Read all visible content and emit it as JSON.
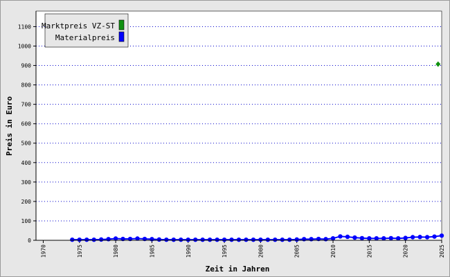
{
  "chart_data": {
    "type": "line",
    "xlabel": "Zeit in Jahren",
    "ylabel": "Preis in Euro",
    "xlim": [
      1969,
      2025
    ],
    "ylim": [
      0,
      1180
    ],
    "x_ticks": [
      1970,
      1975,
      1980,
      1985,
      1990,
      1995,
      2000,
      2005,
      2010,
      2015,
      2020,
      2025
    ],
    "y_ticks": [
      0,
      100,
      200,
      300,
      400,
      500,
      600,
      700,
      800,
      900,
      1000,
      1100
    ],
    "grid": "horizontal-dotted",
    "legend_position": "top-left",
    "series": [
      {
        "name": "Marktpreis VZ-ST",
        "color": "#109010",
        "marker": "diamond",
        "x": [
          2024.5
        ],
        "y": [
          907
        ]
      },
      {
        "name": "Materialpreis",
        "color": "#0000ff",
        "marker": "circle",
        "x": [
          1974,
          1975,
          1976,
          1977,
          1978,
          1979,
          1980,
          1981,
          1982,
          1983,
          1984,
          1985,
          1986,
          1987,
          1988,
          1989,
          1990,
          1991,
          1992,
          1993,
          1994,
          1995,
          1996,
          1997,
          1998,
          1999,
          2000,
          2001,
          2002,
          2003,
          2004,
          2005,
          2006,
          2007,
          2008,
          2009,
          2010,
          2011,
          2012,
          2013,
          2014,
          2015,
          2016,
          2017,
          2018,
          2019,
          2020,
          2021,
          2022,
          2023,
          2024,
          2025
        ],
        "y": [
          3,
          3,
          3,
          3,
          4,
          6,
          9,
          7,
          7,
          9,
          7,
          6,
          4,
          3,
          3,
          3,
          3,
          3,
          3,
          3,
          3,
          3,
          3,
          3,
          3,
          3,
          3,
          3,
          3,
          3,
          3,
          4,
          6,
          6,
          7,
          6,
          10,
          20,
          18,
          14,
          11,
          10,
          10,
          10,
          11,
          10,
          12,
          16,
          17,
          16,
          19,
          24
        ]
      }
    ]
  }
}
